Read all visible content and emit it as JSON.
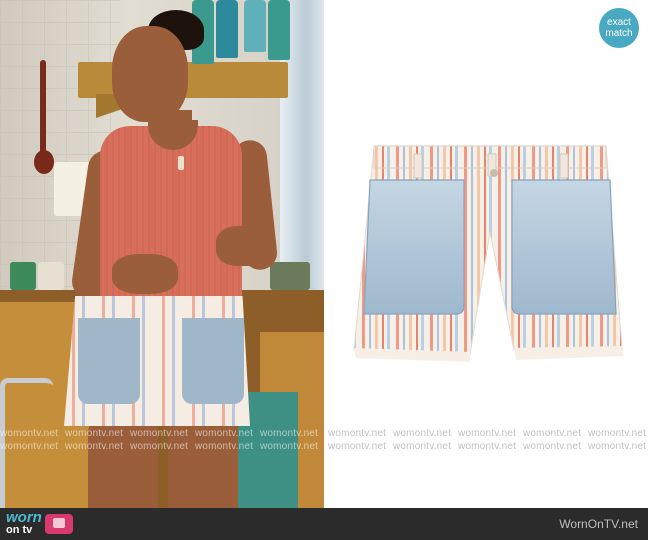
{
  "badge": {
    "line1": "exact",
    "line2": "match"
  },
  "watermark": {
    "text": "womontv.net"
  },
  "footer": {
    "logo_top": "worn",
    "logo_bottom": "on tv",
    "site": "WornOnTV.net"
  },
  "colors": {
    "accent": "#4aa9c2",
    "footer_bg": "#2b2b2b",
    "logo_pink": "#d83a70",
    "tank_top": "#d96f5a",
    "denim": "#a9c4dc"
  },
  "icons": [
    "tv-icon"
  ]
}
